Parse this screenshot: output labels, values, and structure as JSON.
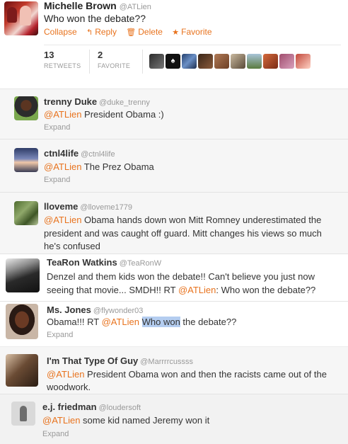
{
  "top_tweet": {
    "name": "Michelle Brown",
    "handle": "@ATLien",
    "text": "Who won the debate??",
    "actions": [
      {
        "label": "Collapse",
        "icon": ""
      },
      {
        "label": "Reply",
        "icon": "reply-arrow-icon"
      },
      {
        "label": "Delete",
        "icon": "trash-icon"
      },
      {
        "label": "Favorite",
        "icon": "star-icon"
      }
    ],
    "stats": {
      "retweets_count": "13",
      "retweets_label": "RETWEETS",
      "favorites_count": "2",
      "favorites_label": "FAVORITE"
    },
    "favoriter_avatar_count": 10
  },
  "colors": {
    "accent": "#e8731e",
    "highlight": "#b4cdf0",
    "reply_bg": "#f6f6f6"
  },
  "replies": [
    {
      "name": "trenny Duke",
      "handle": "@duke_trenny",
      "lines": [
        {
          "mention": "@ATLien",
          "text": " President Obama :)"
        }
      ],
      "expand": "Expand"
    },
    {
      "name": "ctnl4life",
      "handle": "@ctnl4life",
      "lines": [
        {
          "mention": "@ATLien",
          "text": " The Prez Obama"
        }
      ],
      "expand": "Expand"
    },
    {
      "name": "lloveme",
      "handle": "@lloveme1779",
      "lines": [
        {
          "mention": "@ATLien",
          "text": " Obama hands down won Mitt Romney underestimated the"
        },
        {
          "mention": "",
          "text": "president and was caught off guard. Mitt changes his views so much"
        },
        {
          "mention": "",
          "text": "he's confused"
        }
      ],
      "expand": ""
    },
    {
      "name": "TeaRon Watkins",
      "handle": "@TeaRonW",
      "lines": [
        {
          "mention": "",
          "text": "Denzel and them kids won the debate!! Can't believe you just now"
        },
        {
          "mention": "",
          "text": "seeing that movie... SMDH!! RT ",
          "mention_after": "@ATLien",
          "text_after": ": Who won the debate??"
        }
      ],
      "expand": ""
    },
    {
      "name": "Ms. Jones",
      "handle": "@flywonder03",
      "lines": [
        {
          "mention": "",
          "text": "Obama!!! RT ",
          "mention_after": "@ATLien",
          "highlight": "Who won",
          "text_after": " the debate??"
        }
      ],
      "expand": "Expand"
    },
    {
      "name": "I'm That Type Of Guy",
      "handle": "@Marrrrcussss",
      "lines": [
        {
          "mention": "@ATLien",
          "text": " President Obama won and then the racists came out of the"
        },
        {
          "mention": "",
          "text": "woodwork."
        }
      ],
      "expand": ""
    },
    {
      "name": "e.j. friedman",
      "handle": "@loudersoft",
      "lines": [
        {
          "mention": "@ATLien",
          "text": " some kid named Jeremy won it"
        }
      ],
      "expand": "Expand"
    }
  ]
}
